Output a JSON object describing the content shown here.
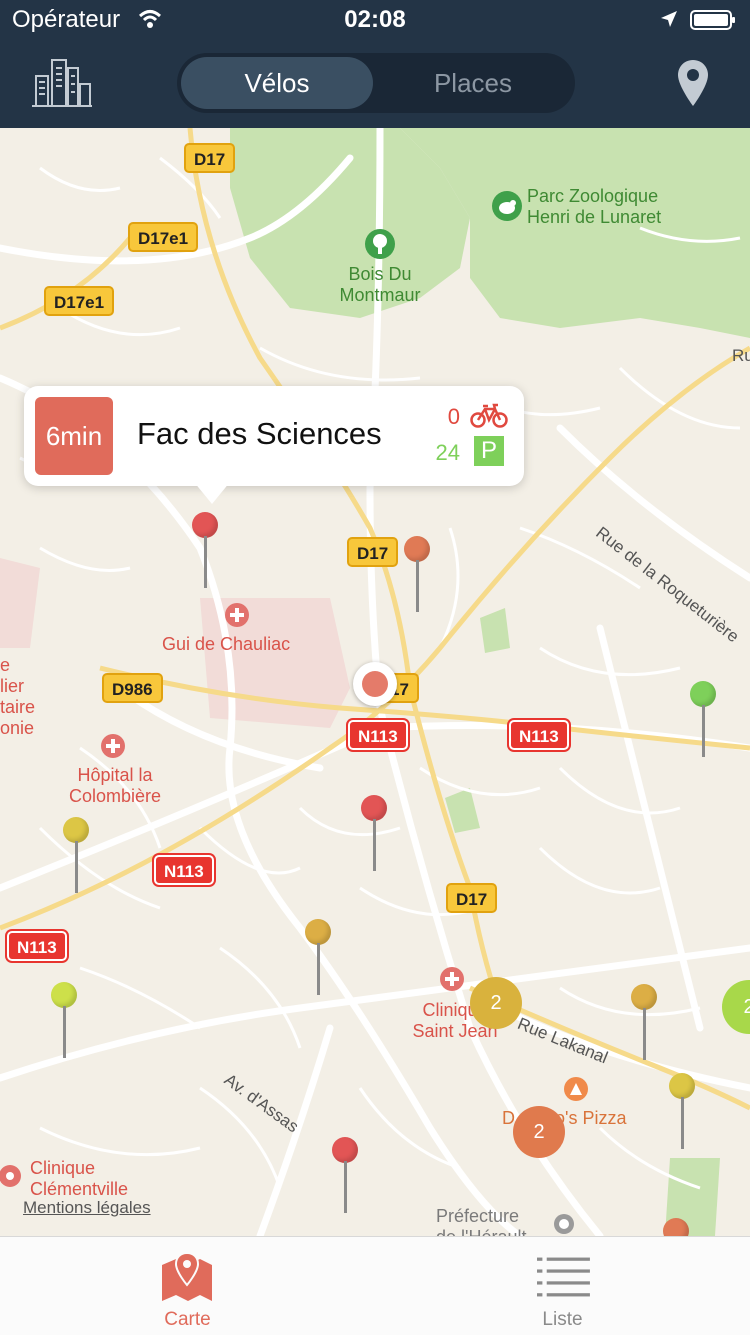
{
  "status_bar": {
    "carrier": "Opérateur",
    "time": "02:08"
  },
  "header": {
    "segments": [
      {
        "label": "Vélos",
        "selected": true
      },
      {
        "label": "Places",
        "selected": false
      }
    ],
    "icons": {
      "left": "city-icon",
      "right": "location-pin-icon"
    }
  },
  "map": {
    "road_labels": {
      "d17_a": "D17",
      "d17e1_a": "D17e1",
      "d17e1_b": "D17e1",
      "d17_b": "D17",
      "d17_c": "17",
      "d986": "D986",
      "n113_a": "N113",
      "n113_b": "N113",
      "n113_c": "N113",
      "n113_d": "N113",
      "d17_d": "D17"
    },
    "pois": {
      "parc_zoo": "Parc Zoologique\nHenri de Lunaret",
      "bois": "Bois Du\nMontmaur",
      "gui": "Gui de Chauliac",
      "hopital_left": "e\nlier\ntaire\nonie",
      "colombiere": "Hôpital la\nColombière",
      "clinique_sj": "Clinique\nSaint Jean",
      "pizza": "D      no's Pizza",
      "clementville": "Clinique\nClémentville",
      "prefecture": "Préfecture\nde l'Hérault"
    },
    "streets": {
      "roqueturiere": "Rue de la Roqueturière",
      "lakanal": "Rue Lakanal",
      "assas": "Av. d'Assas",
      "ru": "Ru"
    },
    "clusters": [
      {
        "count": "2",
        "color": "#d9b23d"
      },
      {
        "count": "2",
        "color": "#e07a4d"
      },
      {
        "count": "2",
        "color": "#a8d84a"
      }
    ],
    "mentions": "Mentions légales",
    "colors": {
      "red": "#e25555",
      "orange": "#e07a55",
      "yellow": "#dcc645",
      "gold": "#dcae45",
      "green": "#7ed05a",
      "lime": "#cde04a"
    }
  },
  "callout": {
    "eta": "6min",
    "station_name": "Fac des Sciences",
    "bikes_available": "0",
    "places_available": "24",
    "bike_icon": "bicycle-icon",
    "parking_icon_label": "P"
  },
  "tabbar": {
    "tabs": [
      {
        "label": "Carte",
        "icon": "map-pin-icon",
        "active": true
      },
      {
        "label": "Liste",
        "icon": "list-icon",
        "active": false
      }
    ]
  }
}
